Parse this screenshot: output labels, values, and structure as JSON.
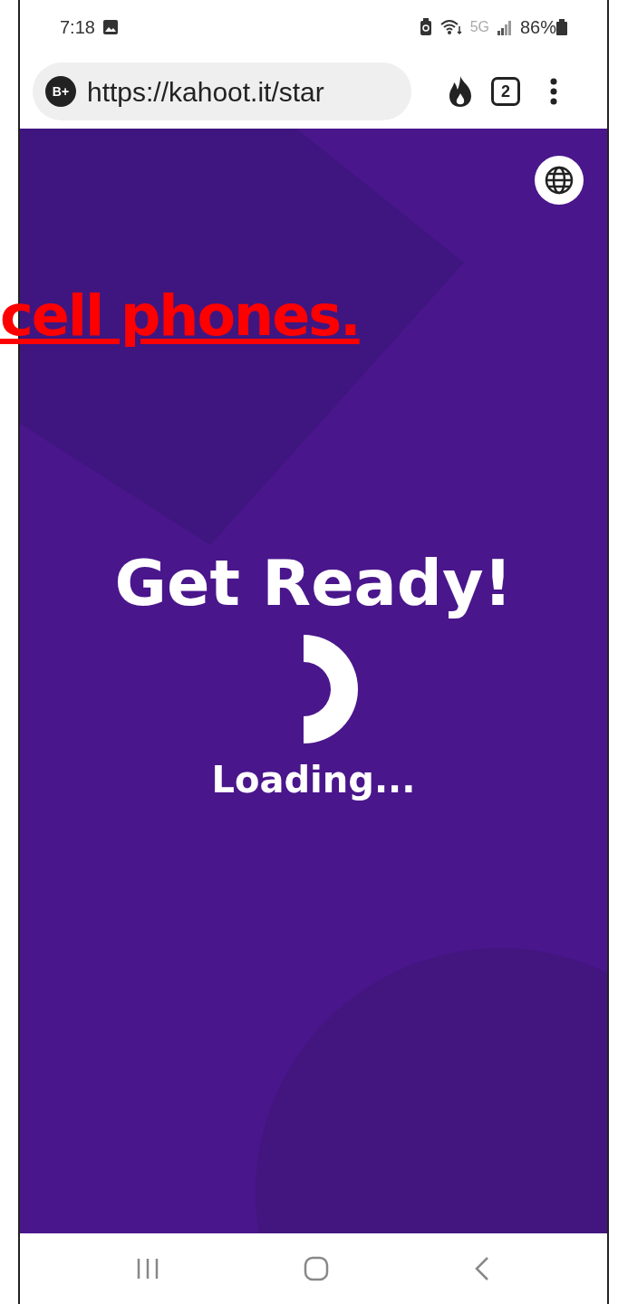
{
  "status_bar": {
    "time": "7:18",
    "network": "5G",
    "battery": "86%"
  },
  "browser": {
    "profile_badge": "B+",
    "url": "https://kahoot.it/star",
    "tab_count": "2"
  },
  "page": {
    "title": "Get Ready!",
    "loading_text": "Loading..."
  },
  "overlay_caption": {
    "text": "cell phones."
  }
}
